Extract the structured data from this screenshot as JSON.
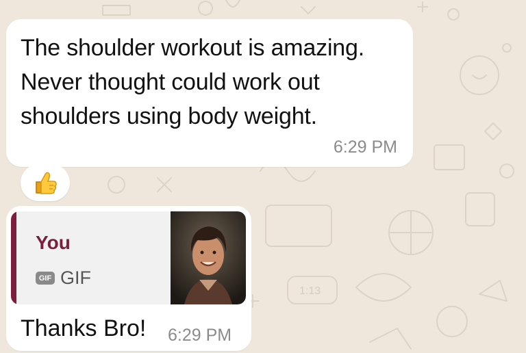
{
  "messages": [
    {
      "text": "The shoulder workout is amazing. Never thought could work out shoulders using body weight.",
      "time": "6:29 PM",
      "reaction": "👍"
    },
    {
      "reply_to": {
        "author": "You",
        "badge": "GIF",
        "label": "GIF"
      },
      "text": "Thanks Bro!",
      "time": "6:29 PM"
    }
  ],
  "colors": {
    "background": "#efe7dc",
    "bubble": "#ffffff",
    "quote_accent": "#7d1e3e",
    "timestamp": "#8b8b8b"
  },
  "icons": {
    "reaction": "thumbs-up-icon",
    "gif_badge": "gif-icon",
    "thumbnail": "gif-thumbnail-photo"
  }
}
